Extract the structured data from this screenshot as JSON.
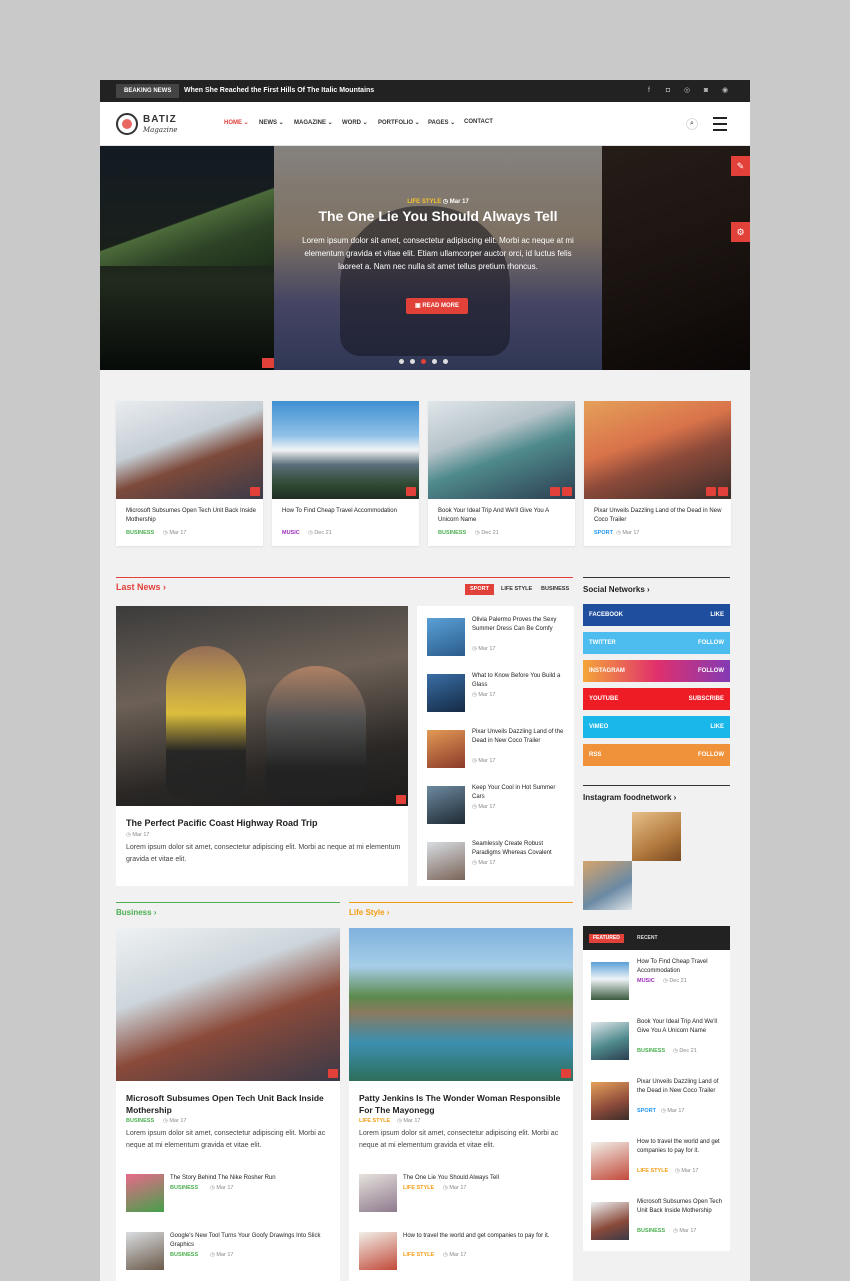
{
  "topbar": {
    "breaking_label": "BEAKING NEWS",
    "breaking_text": "When She Reached the First Hills Of The Italic Mountains",
    "social_icons": [
      "facebook-icon",
      "twitter-icon",
      "skype-icon",
      "instagram-icon",
      "dribbble-icon"
    ]
  },
  "header": {
    "logo_title": "BATIZ",
    "logo_sub": "Magazine",
    "nav": [
      "HOME ⌄",
      "NEWS ⌄",
      "MAGAZINE ⌄",
      "WORD ⌄",
      "PORTFOLIO ⌄",
      "PAGES ⌄",
      "CONTACT"
    ]
  },
  "hero": {
    "category": "LIFE STYLE",
    "date": "◷ Mar 17",
    "title": "The One Lie You Should Always Tell",
    "description": "Lorem ipsum dolor sit amet, consectetur adipiscing elit. Morbi ac neque at mi elementum gravida et vitae elit. Etiam ullamcorper auctor orci, id luctus felis laoreet a. Nam nec nulla sit amet tellus pretium rhoncus.",
    "button": "▣ READ MORE",
    "slides_count": 5,
    "active_slide": 3
  },
  "cards": [
    {
      "title": "Microsoft Subsumes Open Tech Unit Back Inside Mothership",
      "category": "BUSINESS",
      "date": "◷ Mar 17",
      "cat_color": "#4caf50"
    },
    {
      "title": "How To Find Cheap Travel Accommodation",
      "category": "MUSIC",
      "date": "◷ Dec 21",
      "cat_color": "#9b30b8"
    },
    {
      "title": "Book Your Ideal Trip And We'll Give You A Unicorn Name",
      "category": "BUSINESS",
      "date": "◷ Dec 21",
      "cat_color": "#4caf50"
    },
    {
      "title": "Pixar Unveils Dazzling Land of the Dead in New Coco Trailer",
      "category": "SPORT",
      "date": "◷ Mar 17",
      "cat_color": "#2196f3"
    }
  ],
  "last_news": {
    "title": "Last News ›",
    "tabs": [
      "SPORT",
      "LIFE STYLE",
      "BUSINESS"
    ],
    "main": {
      "title": "The Perfect Pacific Coast Highway Road Trip",
      "date": "◷ Mar 17",
      "description": "Lorem ipsum dolor sit amet, consectetur adipiscing elit. Morbi ac neque at mi elementum gravida et vitae elit."
    },
    "list": [
      {
        "title": "Olivia Palermo Proves the Sexy Summer Dress Can Be Comfy",
        "date": "◷ Mar 17"
      },
      {
        "title": "What to Know Before You Build a Glass",
        "date": "◷ Mar 17"
      },
      {
        "title": "Pixar Unveils Dazzling Land of the Dead in New Coco Trailer",
        "date": "◷ Mar 17"
      },
      {
        "title": "Keep Your Cool in Hot Summer Cars",
        "date": "◷ Mar 17"
      },
      {
        "title": "Seamlessly Create Robust Paradigms Whereas Covalent",
        "date": "◷ Mar 17"
      }
    ]
  },
  "social": {
    "title": "Social Networks ›",
    "items": [
      {
        "name": "FACEBOOK",
        "action": "LIKE",
        "color": "#1f4e9e"
      },
      {
        "name": "TWITTER",
        "action": "FOLLOW",
        "color": "#4dbcee"
      },
      {
        "name": "INSTAGRAM",
        "action": "FOLLOW",
        "color": "#c13584"
      },
      {
        "name": "YOUTUBE",
        "action": "SUBSCRIBE",
        "color": "#ee1c25"
      },
      {
        "name": "VIMEO",
        "action": "LIKE",
        "color": "#1ab7ea"
      },
      {
        "name": "RSS",
        "action": "FOLLOW",
        "color": "#f0923a"
      }
    ]
  },
  "instagram": {
    "title": "Instagram foodnetwork ›"
  },
  "business": {
    "title": "Business ›",
    "main": {
      "title": "Microsoft Subsumes Open Tech Unit Back Inside Mothership",
      "category": "BUSINESS",
      "date": "◷ Mar 17",
      "description": "Lorem ipsum dolor sit amet, consectetur adipiscing elit. Morbi ac neque at mi elementum gravida et vitae elit."
    },
    "list": [
      {
        "title": "The Story Behind The Nike Rosher Run",
        "category": "BUSINESS",
        "date": "◷ Mar 17"
      },
      {
        "title": "Google's New Tool Turns Your Goofy Drawings Into Slick Graphics",
        "category": "BUSINESS",
        "date": "◷ Mar 17"
      }
    ]
  },
  "lifestyle": {
    "title": "Life Style ›",
    "main": {
      "title": "Patty Jenkins Is The Wonder Woman Responsible For The Mayonegg",
      "category": "LIFE STYLE",
      "date": "◷ Mar 17",
      "description": "Lorem ipsum dolor sit amet, consectetur adipiscing elit. Morbi ac neque at mi elementum gravida et vitae elit."
    },
    "list": [
      {
        "title": "The One Lie You Should Always Tell",
        "category": "LIFE STYLE",
        "date": "◷ Mar 17"
      },
      {
        "title": "How to travel the world and get companies to pay for it.",
        "category": "LIFE STYLE",
        "date": "◷ Mar 17"
      }
    ]
  },
  "featured": {
    "tabs": [
      "FEATURED",
      "RECENT"
    ],
    "items": [
      {
        "title": "How To Find Cheap Travel Accommodation",
        "category": "MUSIC",
        "date": "◷ Dec 21",
        "cat_color": "#9b30b8"
      },
      {
        "title": "Book Your Ideal Trip And We'll Give You A Unicorn Name",
        "category": "BUSINESS",
        "date": "◷ Dec 21",
        "cat_color": "#4caf50"
      },
      {
        "title": "Pixar Unveils Dazzling Land of the Dead in New Coco Trailer",
        "category": "SPORT",
        "date": "◷ Mar 17",
        "cat_color": "#2196f3"
      },
      {
        "title": "How to travel the world and get companies to pay for it.",
        "category": "LIFE STYLE",
        "date": "◷ Mar 17",
        "cat_color": "#f39c12"
      },
      {
        "title": "Microsoft Subsumes Open Tech Unit Back Inside Mothership",
        "category": "BUSINESS",
        "date": "◷ Mar 17",
        "cat_color": "#4caf50"
      }
    ]
  }
}
